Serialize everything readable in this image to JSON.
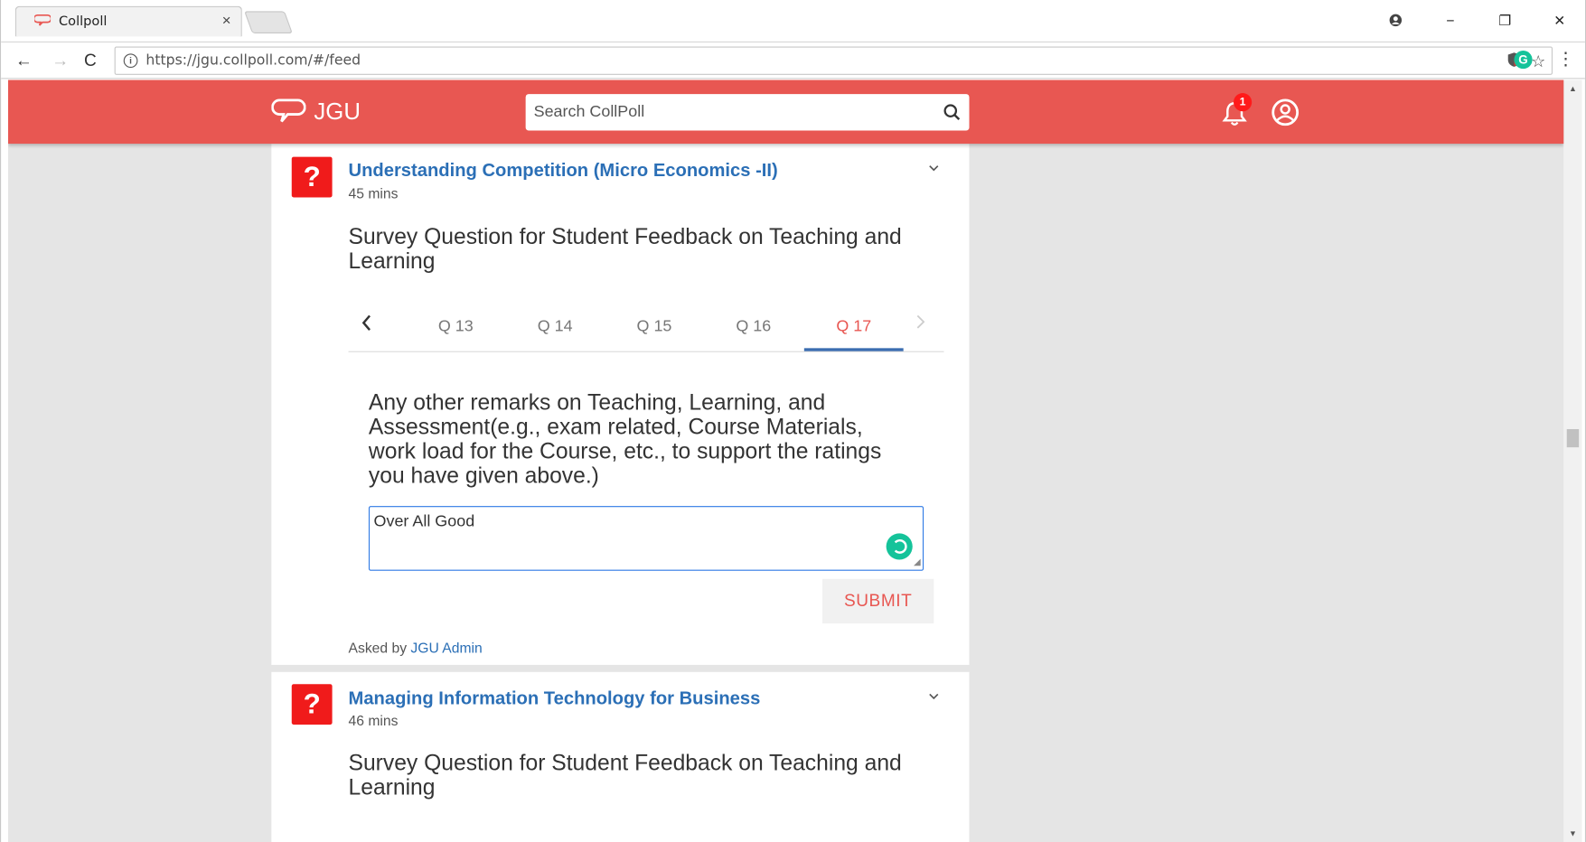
{
  "browser": {
    "tab_title": "Collpoll",
    "tab_close": "×",
    "url_host": "https://jgu.collpoll.com",
    "url_path": "/#/feed",
    "window_controls": [
      "−",
      "❐",
      "✕"
    ]
  },
  "header": {
    "brand": "JGU",
    "search_placeholder": "Search CollPoll",
    "notification_count": "1",
    "accent_color": "#e85752"
  },
  "feed": [
    {
      "icon": "?",
      "course": "Understanding Competition (Micro Economics -II)",
      "time": "45 mins",
      "survey_title": "Survey Question for Student Feedback on Teaching and Learning",
      "tabs": [
        "Q 13",
        "Q 14",
        "Q 15",
        "Q 16",
        "Q 17"
      ],
      "active_tab": "Q 17",
      "question": "Any other remarks on Teaching, Learning, and Assessment(e.g., exam related, Course Materials, work load for the Course, etc., to support the ratings you have given above.)",
      "answer": "Over All Good",
      "submit_label": "SUBMIT",
      "asked_by_prefix": "Asked by",
      "asked_by": "JGU Admin"
    },
    {
      "icon": "?",
      "course": "Managing Information Technology for Business",
      "time": "46 mins",
      "survey_title": "Survey Question for Student Feedback on Teaching and Learning"
    }
  ]
}
